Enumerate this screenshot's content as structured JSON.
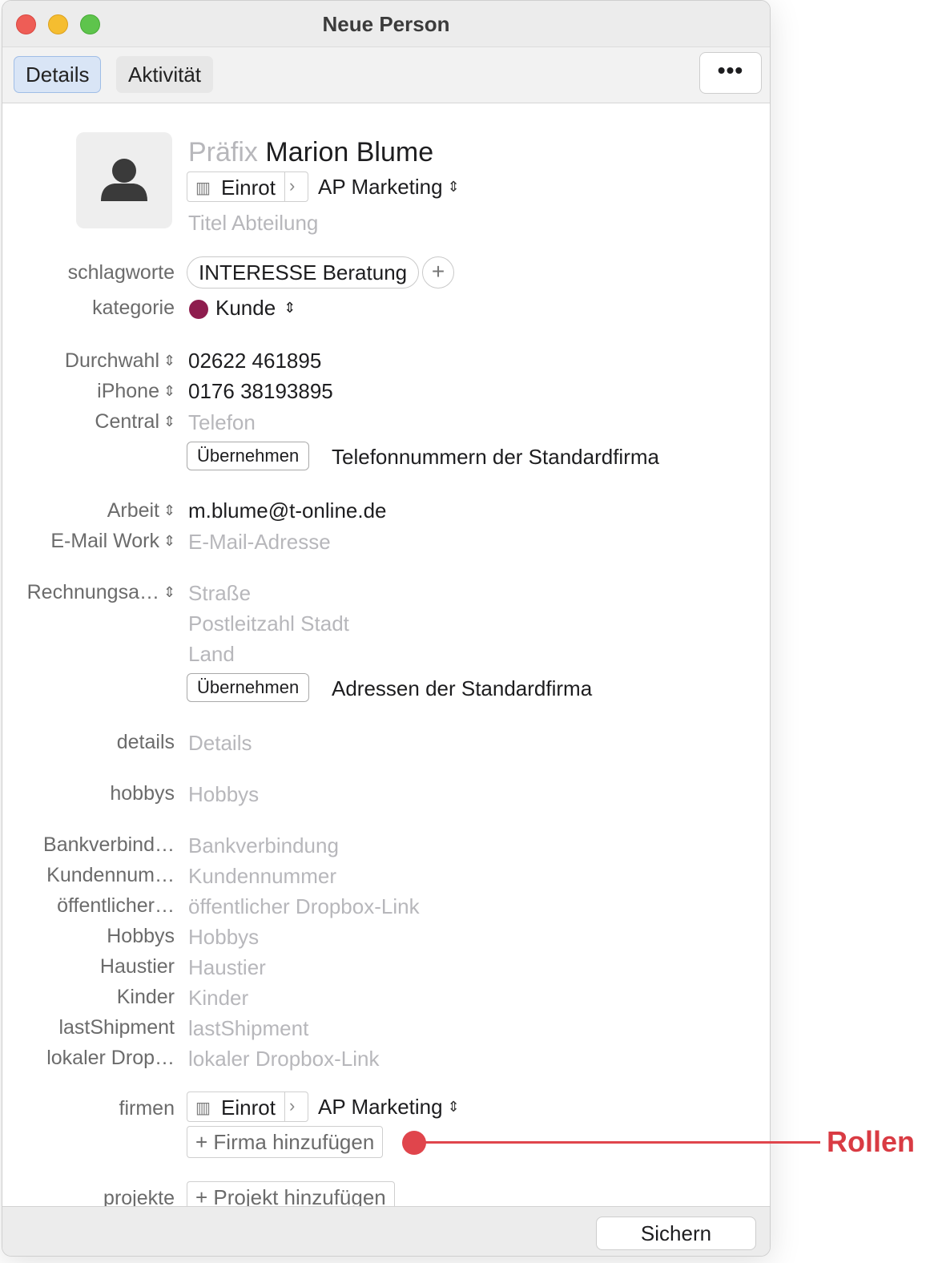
{
  "window": {
    "title": "Neue Person"
  },
  "toolbar": {
    "tab_details": "Details",
    "tab_activity": "Aktivität",
    "more_label": "•••"
  },
  "header": {
    "prefix_placeholder": "Präfix",
    "name": "Marion Blume",
    "company": "Einrot",
    "role": "AP Marketing",
    "title_placeholder": "Titel Abteilung"
  },
  "tags": {
    "label": "schlagworte",
    "value": "INTERESSE Beratung"
  },
  "category": {
    "label": "kategorie",
    "value": "Kunde",
    "color": "#8e1d4e"
  },
  "phones": {
    "items": [
      {
        "label": "Durchwahl",
        "value": "02622 461895"
      },
      {
        "label": "iPhone",
        "value": "0176 38193895"
      },
      {
        "label": "Central",
        "placeholder": "Telefon"
      }
    ],
    "adopt_button": "Übernehmen",
    "adopt_text": "Telefonnummern der Standardfirma"
  },
  "emails": {
    "items": [
      {
        "label": "Arbeit",
        "value": "m.blume@t-online.de"
      },
      {
        "label": "E-Mail Work",
        "placeholder": "E-Mail-Adresse"
      }
    ]
  },
  "address": {
    "label": "Rechnungsa…",
    "street_placeholder": "Straße",
    "city_placeholder": "Postleitzahl Stadt",
    "country_placeholder": "Land",
    "adopt_button": "Übernehmen",
    "adopt_text": "Adressen der Standardfirma"
  },
  "details": {
    "label": "details",
    "placeholder": "Details"
  },
  "hobbys": {
    "label": "hobbys",
    "placeholder": "Hobbys"
  },
  "custom_fields": [
    {
      "label": "Bankverbind…",
      "placeholder": "Bankverbindung"
    },
    {
      "label": "Kundennum…",
      "placeholder": "Kundennummer"
    },
    {
      "label": "öffentlicher…",
      "placeholder": "öffentlicher Dropbox-Link"
    },
    {
      "label": "Hobbys",
      "placeholder": "Hobbys"
    },
    {
      "label": "Haustier",
      "placeholder": "Haustier"
    },
    {
      "label": "Kinder",
      "placeholder": "Kinder"
    },
    {
      "label": "lastShipment",
      "placeholder": "lastShipment"
    },
    {
      "label": "lokaler Drop…",
      "placeholder": "lokaler Dropbox-Link"
    }
  ],
  "companies": {
    "label": "firmen",
    "company": "Einrot",
    "role": "AP Marketing",
    "add_button": "+ Firma hinzufügen"
  },
  "projects": {
    "label": "projekte",
    "add_button": "+ Projekt hinzufügen"
  },
  "footer": {
    "save_button": "Sichern"
  },
  "annotation": {
    "text": "Rollen",
    "color": "#d93b43"
  }
}
